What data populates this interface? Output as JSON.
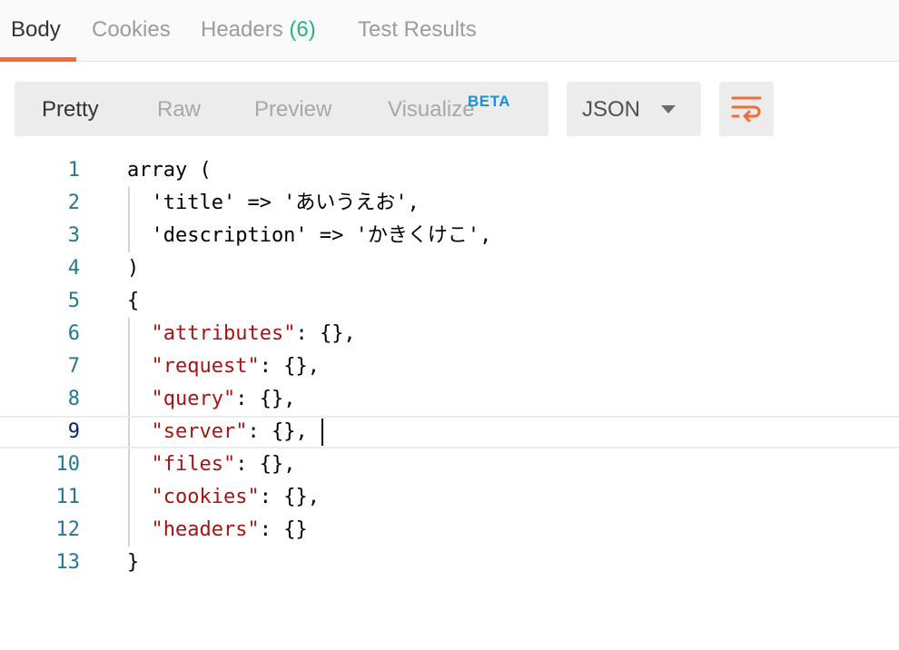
{
  "tabs": [
    {
      "label": "Body"
    },
    {
      "label": "Cookies"
    },
    {
      "label": "Headers",
      "count": "(6)"
    },
    {
      "label": "Test Results"
    }
  ],
  "view_modes": [
    "Pretty",
    "Raw",
    "Preview",
    "Visualize"
  ],
  "visualize_badge": "BETA",
  "format": {
    "selected": "JSON"
  },
  "editor": {
    "line_numbers": [
      "1",
      "2",
      "3",
      "4",
      "5",
      "6",
      "7",
      "8",
      "9",
      "10",
      "11",
      "12",
      "13"
    ],
    "lines": [
      {
        "text": "array ("
      },
      {
        "text": "  'title' => 'あいうえお',"
      },
      {
        "text": "  'description' => 'かきくけこ',"
      },
      {
        "text": ")"
      },
      {
        "text": "{"
      },
      {
        "indent": "  ",
        "key": "\"attributes\"",
        "rest": ": {},"
      },
      {
        "indent": "  ",
        "key": "\"request\"",
        "rest": ": {},"
      },
      {
        "indent": "  ",
        "key": "\"query\"",
        "rest": ": {},"
      },
      {
        "indent": "  ",
        "key": "\"server\"",
        "rest": ": {},"
      },
      {
        "indent": "  ",
        "key": "\"files\"",
        "rest": ": {},"
      },
      {
        "indent": "  ",
        "key": "\"cookies\"",
        "rest": ": {},"
      },
      {
        "indent": "  ",
        "key": "\"headers\"",
        "rest": ": {}"
      },
      {
        "text": "}"
      }
    ],
    "current_line": "9"
  },
  "colors": {
    "accent": "#f26b3a",
    "count": "#26b47f",
    "beta": "#1a8ee0",
    "string": "#a31515",
    "line_number": "#237893"
  },
  "icons": {
    "wrap": "wrap-lines-icon",
    "dropdown": "chevron-down-icon"
  }
}
